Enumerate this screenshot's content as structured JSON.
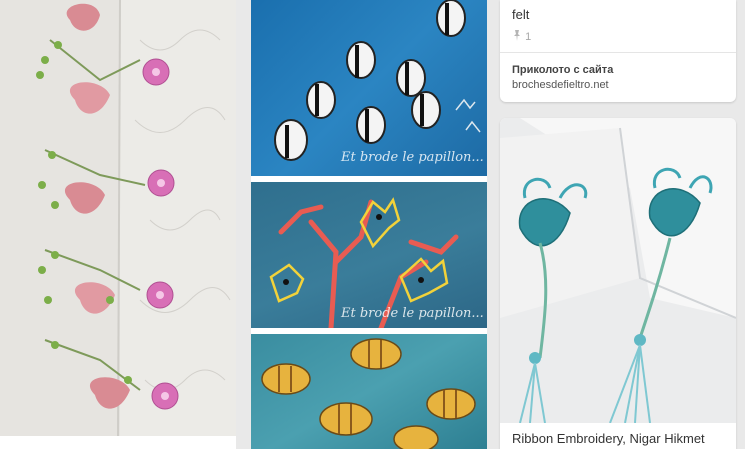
{
  "colors": {
    "page_bg": "#e9e9e9",
    "card_bg": "#ffffff",
    "text_primary": "#333333",
    "text_muted": "#a8a8a8"
  },
  "pins": {
    "embroidery_tulips": {
      "icon": "image"
    },
    "fish": {
      "watermark_1": "Et brode le papillon...",
      "watermark_2": "Et brode le papillon..."
    },
    "felt": {
      "description": "felt",
      "repin_icon": "pin-icon",
      "repin_count": "1",
      "source_label": "Приколото с сайта",
      "source_domain": "brochesdefieltro.net"
    },
    "ribbon": {
      "title": "Ribbon Embroidery, Nigar Hikmet"
    }
  }
}
